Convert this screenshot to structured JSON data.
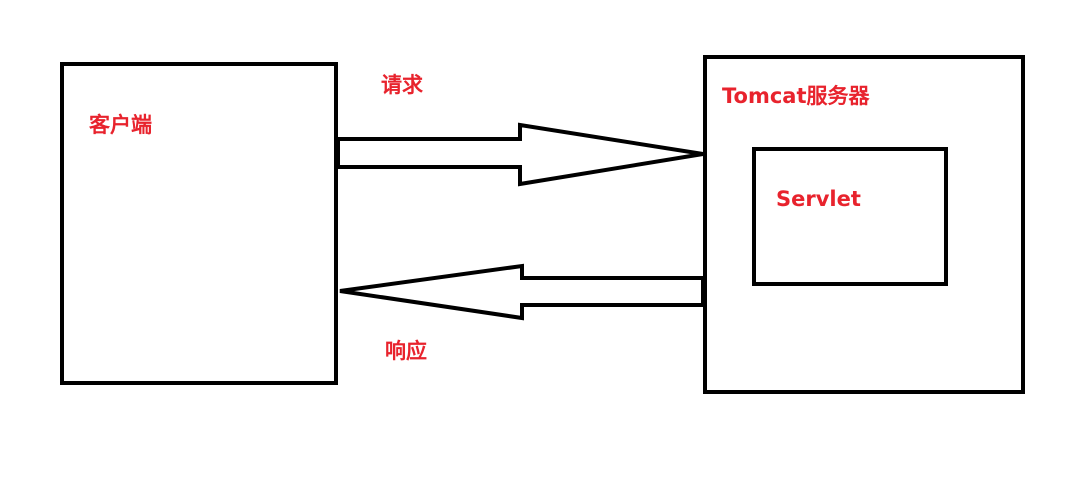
{
  "client": {
    "label": "客户端"
  },
  "server": {
    "label": "Tomcat服务器"
  },
  "servlet": {
    "label": "Servlet"
  },
  "request": {
    "label": "请求"
  },
  "response": {
    "label": "响应"
  },
  "colors": {
    "label": "#e8232d",
    "stroke": "#000000"
  }
}
